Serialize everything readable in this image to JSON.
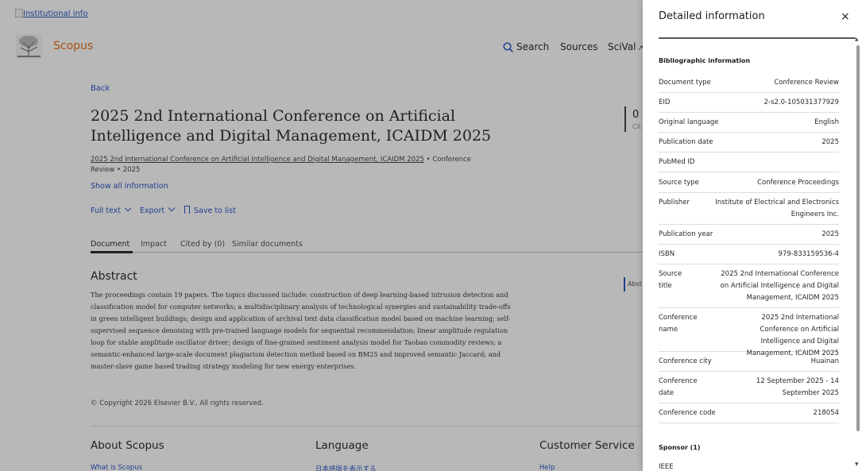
{
  "header": {
    "institutional_link": "Institutional info",
    "logo_text": "Scopus",
    "nav": {
      "search": "Search",
      "sources": "Sources",
      "scival": "SciVal"
    }
  },
  "document": {
    "back": "Back",
    "title": "2025 2nd International Conference on Artificial Intelligence and Digital Management, ICAIDM 2025",
    "source_link": "2025 2nd International Conference on Artificial Intelligence and Digital Management, ICAIDM 2025",
    "doc_type": "Conference Review",
    "year": "2025",
    "show_all": "Show all information",
    "citations_count": "0",
    "citations_label": "Cit",
    "actions": {
      "full_text": "Full text",
      "export": "Export",
      "save": "Save to list"
    },
    "tabs": [
      "Document",
      "Impact",
      "Cited by (0)",
      "Similar documents"
    ],
    "abstract_heading": "Abstract",
    "abstract_text": "The proceedings contain 19 papers. The topics discussed include: construction of deep learning-based intrusion detection and classification model for computer networks; a multidisciplinary analysis of technological synergies and sustainability trade-offs in green intelligent buildings; design and application of archival text data classification model based on machine learning; self-supervised sequence denoising with pre-trained language models for sequential recommendation; linear amplitude regulation loop for stable amplitude oscillator driver; design of fine-grained sentiment analysis model for Taobao commodity reviews; a semantic-enhanced large-scale document plagiarism detection method based on BM25 and improved semantic Jaccard; and master-slave game based trading strategy modeling for new energy enterprises.",
    "abstract_marker": "Abst",
    "copyright": "© Copyright 2026 Elsevier B.V., All rights reserved."
  },
  "footer": {
    "about_heading": "About Scopus",
    "about_link": "What is Scopus",
    "language_heading": "Language",
    "language_link": "日本語版を表示する",
    "service_heading": "Customer Service",
    "service_link": "Help"
  },
  "panel": {
    "title": "Detailed information",
    "close": "×",
    "section": "Bibliographic information",
    "rows": [
      {
        "key": "Document type",
        "value": "Conference Review"
      },
      {
        "key": "EID",
        "value": "2-s2.0-105031377929"
      },
      {
        "key": "Original language",
        "value": "English"
      },
      {
        "key": "Publication date",
        "value": "2025"
      },
      {
        "key": "PubMed ID",
        "value": ""
      },
      {
        "key": "Source type",
        "value": "Conference Proceedings"
      },
      {
        "key": "Publisher",
        "value": "Institute of Electrical and Electronics Engineers Inc."
      },
      {
        "key": "Publication year",
        "value": "2025"
      },
      {
        "key": "ISBN",
        "value": "979-833159536-4"
      },
      {
        "key": "Source title",
        "value": "2025 2nd International Conference on Artificial Intelligence and Digital Management, ICAIDM 2025"
      },
      {
        "key": "Conference name",
        "value": "2025 2nd International Conference on Artificial Intelligence and Digital Management, ICAIDM 2025"
      },
      {
        "key": "Conference city",
        "value": "Huainan"
      },
      {
        "key": "Conference date",
        "value": "12 September 2025 - 14 September 2025"
      },
      {
        "key": "Conference code",
        "value": "218054"
      }
    ],
    "sponsor_heading": "Sponsor (1)",
    "sponsor_value": "IEEE"
  }
}
